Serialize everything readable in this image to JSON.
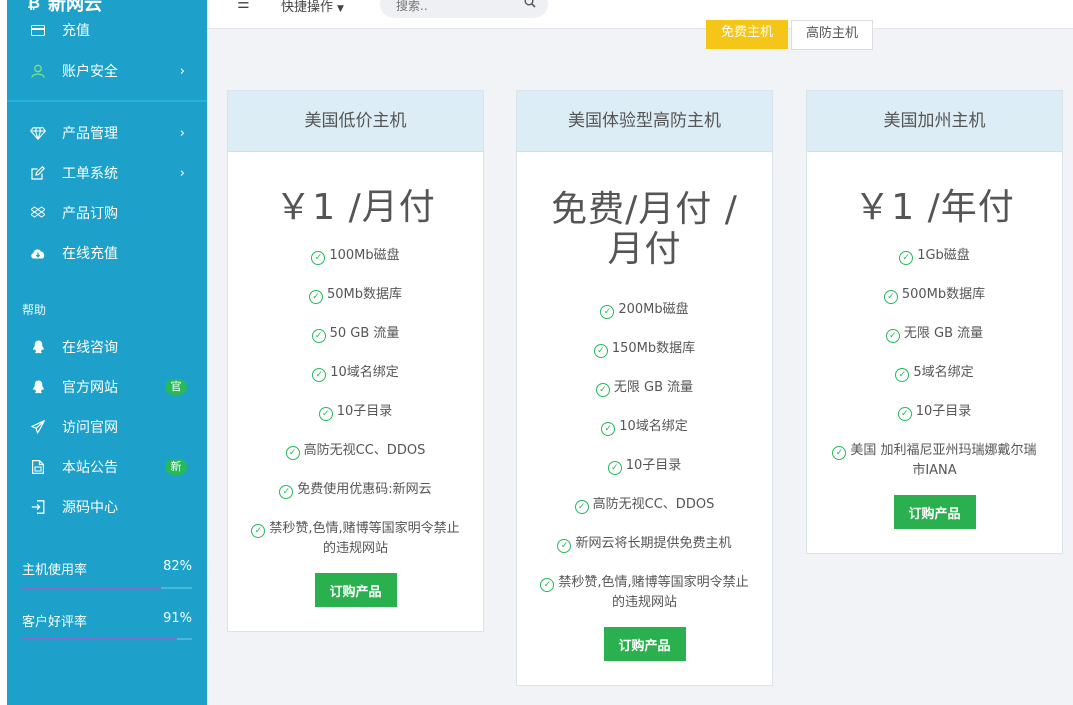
{
  "brand": {
    "name": "新网云",
    "icon": "bitcoin-icon"
  },
  "sidebar": {
    "items": [
      {
        "label": "充值",
        "icon": "card-icon"
      },
      {
        "label": "账户安全",
        "icon": "user-icon",
        "chevron": "›"
      },
      {
        "label": "产品管理",
        "icon": "diamond-icon",
        "chevron": "›"
      },
      {
        "label": "工单系统",
        "icon": "edit-icon",
        "chevron": "›"
      },
      {
        "label": "产品订购",
        "icon": "dropbox-icon"
      },
      {
        "label": "在线充值",
        "icon": "cloud-download-icon"
      }
    ],
    "help_label": "帮助",
    "help_items": [
      {
        "label": "在线咨询",
        "icon": "qq-icon"
      },
      {
        "label": "官方网站",
        "icon": "qq-icon",
        "badge": "官"
      },
      {
        "label": "访问官网",
        "icon": "paper-plane-icon"
      },
      {
        "label": "本站公告",
        "icon": "file-icon",
        "badge": "新"
      },
      {
        "label": "源码中心",
        "icon": "sign-in-icon"
      }
    ],
    "stats": [
      {
        "name": "主机使用率",
        "pct": "82%",
        "value": 0.82
      },
      {
        "name": "客户好评率",
        "pct": "91%",
        "value": 0.91
      }
    ]
  },
  "header": {
    "quick_ops": "快捷操作",
    "search_placeholder": "搜索.."
  },
  "filters": {
    "free": "免费主机",
    "high_defense": "高防主机"
  },
  "cards": [
    {
      "title": "美国低价主机",
      "price": "￥1 /月付",
      "features": [
        "100Mb磁盘",
        "50Mb数据库",
        "50 GB 流量",
        "10域名绑定",
        "10子目录",
        "高防无视CC、DDOS",
        "免费使用优惠码:新网云",
        "禁秒赞,色情,赌博等国家明令禁止的违规网站"
      ],
      "button": "订购产品"
    },
    {
      "title": "美国体验型高防主机",
      "price": "免费/月付 /月付",
      "features": [
        "200Mb磁盘",
        "150Mb数据库",
        "无限 GB 流量",
        "10域名绑定",
        "10子目录",
        "高防无视CC、DDOS",
        "新网云将长期提供免费主机",
        "禁秒赞,色情,赌博等国家明令禁止的违规网站"
      ],
      "button": "订购产品"
    },
    {
      "title": "美国加州主机",
      "price": "￥1 /年付",
      "features": [
        "1Gb磁盘",
        "500Mb数据库",
        "无限 GB 流量",
        "5域名绑定",
        "10子目录",
        "美国 加利福尼亚州玛瑞娜戴尔瑞市IANA"
      ],
      "button": "订购产品"
    }
  ],
  "colors": {
    "sidebar": "#1da1cb",
    "buy": "#2bb04f",
    "badge": "#27b95a",
    "free_tab": "#f5c518"
  }
}
